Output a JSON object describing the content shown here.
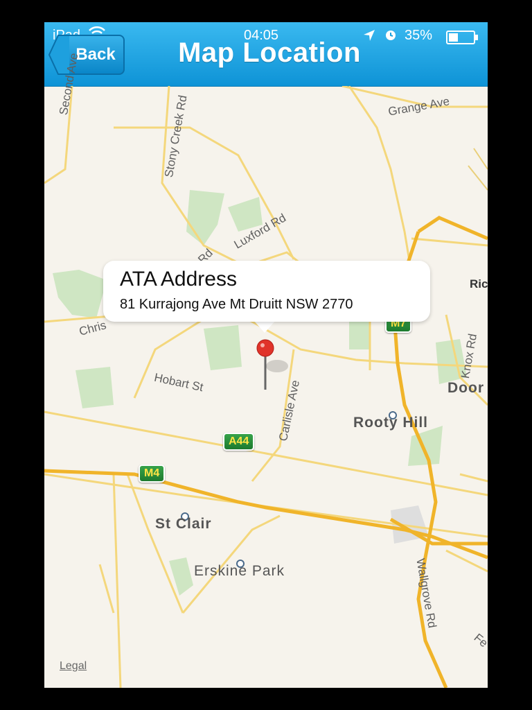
{
  "status_bar": {
    "device": "iPad",
    "time": "04:05",
    "battery": "35%"
  },
  "navbar": {
    "back_label": "Back",
    "title": "Map Location",
    "color": "#1aa3e0"
  },
  "callout": {
    "title": "ATA Address",
    "subtitle": "81 Kurrajong Ave Mt Druitt NSW 2770"
  },
  "map": {
    "streets": {
      "second_ave": "Second Ave",
      "stony_creek": "Stony Creek Rd",
      "grange_ave": "Grange Ave",
      "luxford": "Luxford Rd",
      "rd": "Rd",
      "christie": "Chris",
      "hobart": "Hobart St",
      "carlisle": "Carlisle Ave",
      "knox": "Knox Rd",
      "wallgrove": "Wallgrove Rd",
      "ric": "Ric",
      "fe": "Fe"
    },
    "suburbs": {
      "rooty_hill": "Rooty Hill",
      "st_clair": "St Clair",
      "erskine_park": "Erskine Park",
      "doon": "Door"
    },
    "shields": {
      "a44": "A44",
      "m4": "M4",
      "m7": "M7"
    },
    "legal": "Legal"
  }
}
